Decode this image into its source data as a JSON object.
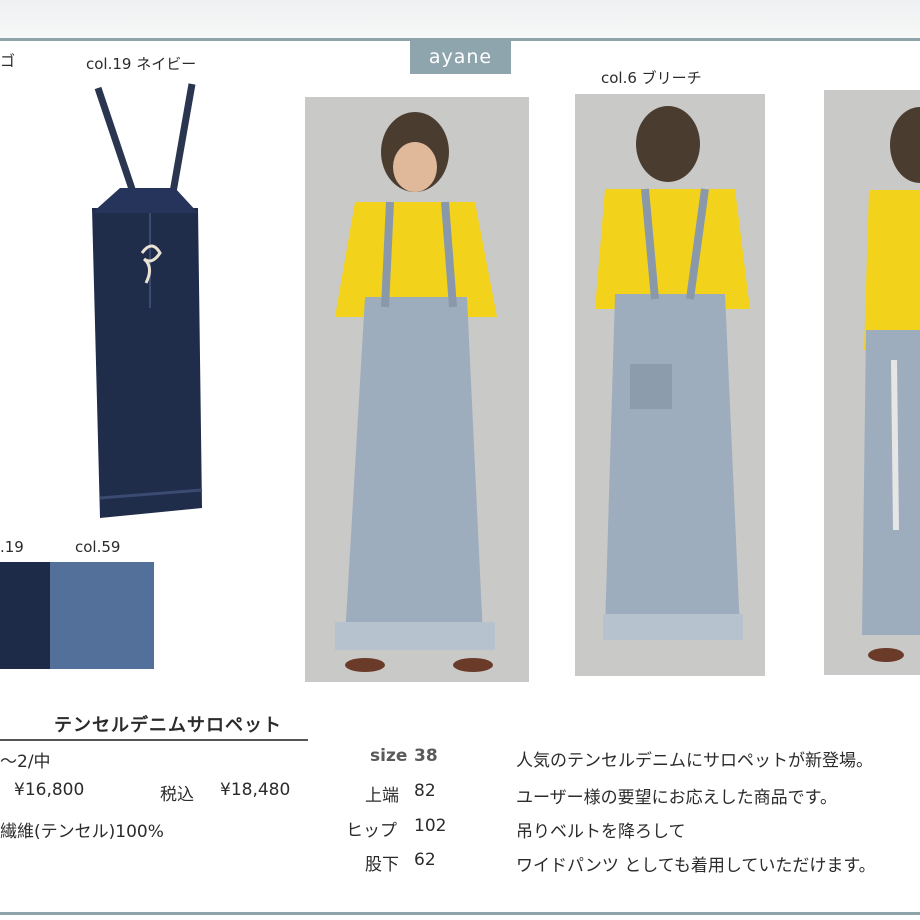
{
  "brand": "ayane",
  "labels": {
    "corner_fragment": "ゴ",
    "navy_label": "col.19 ネイビー",
    "bleach_label": "col.6 ブリーチ",
    "swatch_left_label": ".19",
    "swatch_right_label": "col.59"
  },
  "product": {
    "name": "テンセルデニムサロペット",
    "size_range": "〜2/中",
    "price": "¥16,800",
    "price_tax_label": "税込",
    "price_tax": "¥18,480",
    "material": "繊維(テンセル)100%"
  },
  "sizes": {
    "size_label": "size",
    "size_value": "38",
    "top_label": "上端",
    "top_value": "82",
    "hip_label": "ヒップ",
    "hip_value": "102",
    "inseam_label": "股下",
    "inseam_value": "62"
  },
  "description": [
    "人気のテンセルデニムにサロペットが新登場。",
    "ユーザー様の要望にお応えした商品です。",
    "吊りベルトを降ろして",
    "ワイドパンツ としても着用していただけます。"
  ],
  "colors": {
    "navy": "#1f2c4a",
    "denim_light": "#9eadbd",
    "swatch_blue": "#52709a",
    "shirt_yellow": "#f3d21c",
    "photo_bg": "#c9c9c7",
    "accent": "#8fa5ad"
  }
}
